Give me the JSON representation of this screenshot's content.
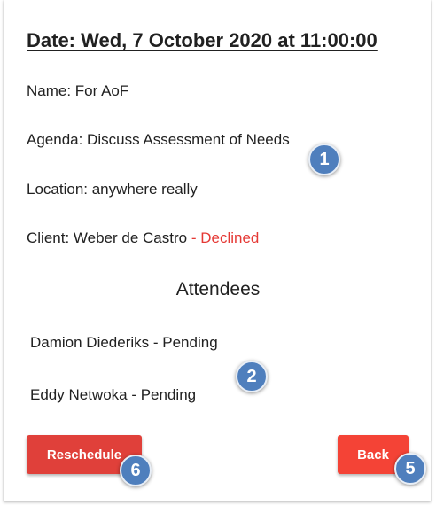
{
  "meeting": {
    "date_line": "Date: Wed, 7 October 2020 at 11:00:00",
    "name_line": "Name: For AoF",
    "agenda_line": "Agenda: Discuss Assessment of Needs",
    "location_line": "Location: anywhere really",
    "client_label": "Client: Weber de Castro",
    "client_status": " - Declined"
  },
  "attendees": {
    "heading": "Attendees",
    "items": [
      {
        "text": "Damion Diederiks - Pending"
      },
      {
        "text": "Eddy Netwoka - Pending"
      }
    ]
  },
  "actions": {
    "reschedule_label": "Reschedule",
    "back_label": "Back"
  },
  "markers": [
    "1",
    "2",
    "5",
    "6"
  ],
  "colors": {
    "declined": "#e53935",
    "button_red": "#f44336",
    "marker_blue": "#4f7fbd"
  }
}
